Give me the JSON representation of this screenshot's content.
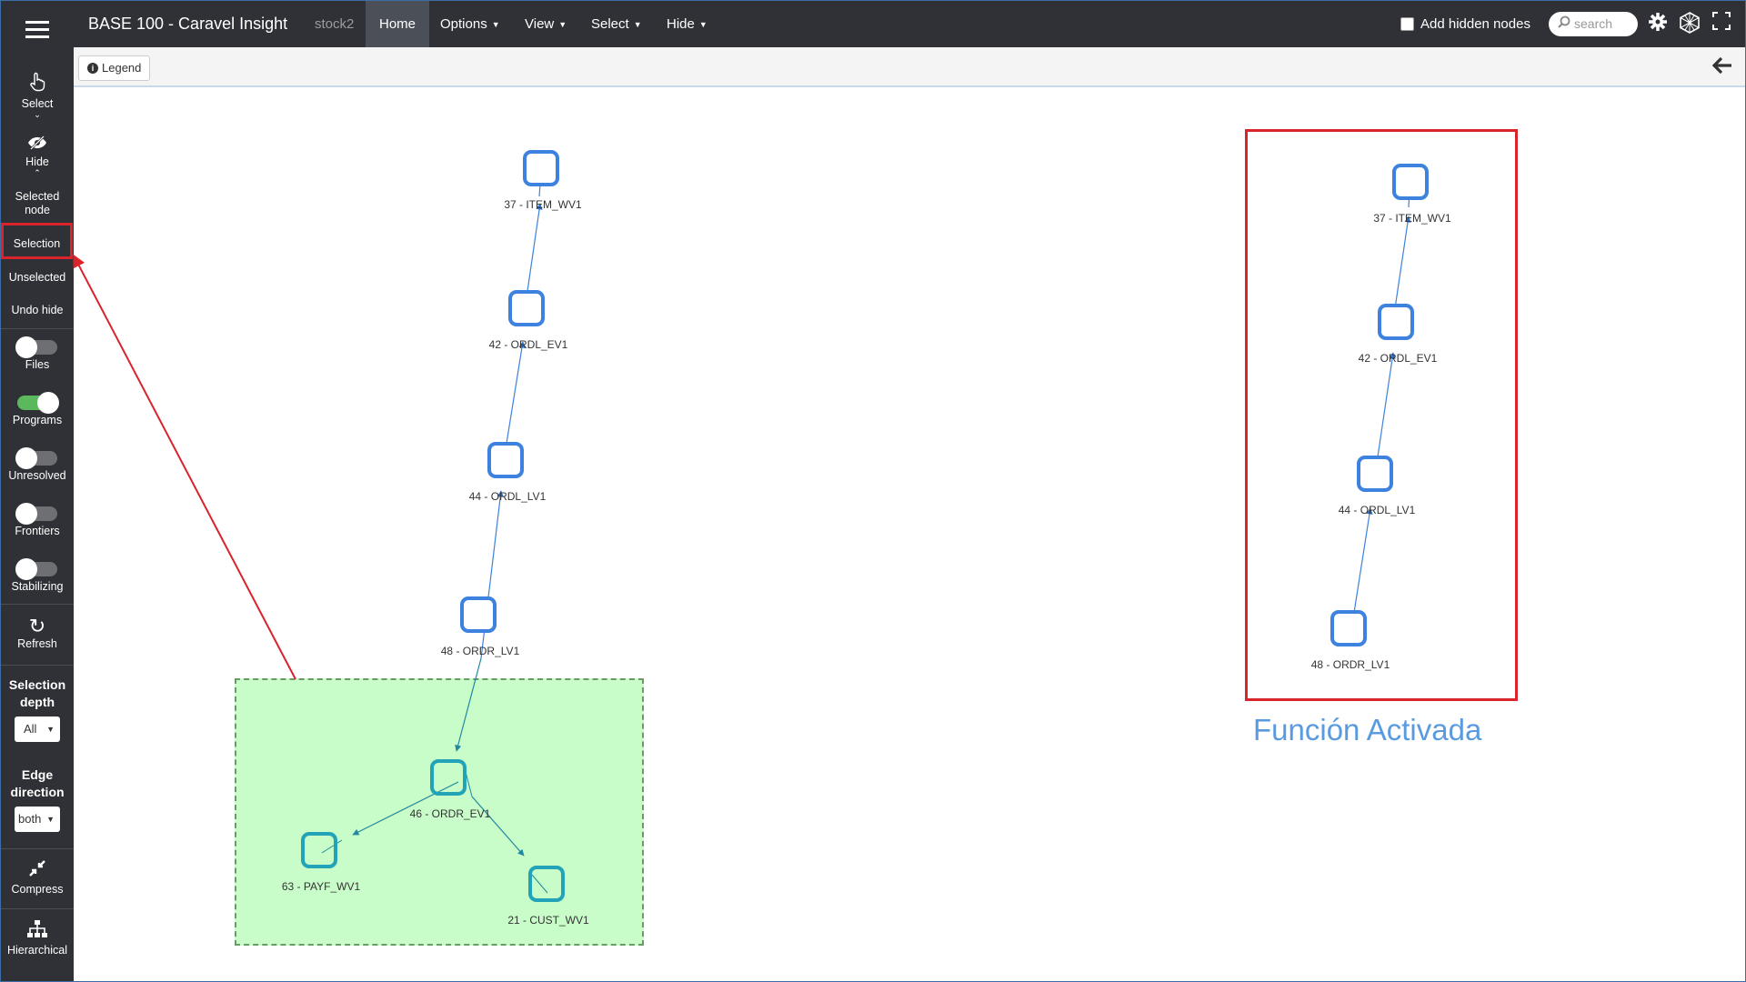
{
  "app": {
    "title": "BASE 100 - Caravel Insight",
    "project": "stock2"
  },
  "topnav": {
    "home": "Home",
    "options": "Options",
    "view": "View",
    "select": "Select",
    "hide": "Hide",
    "add_hidden_nodes": "Add hidden nodes",
    "search_placeholder": "search"
  },
  "subbar": {
    "legend": "Legend"
  },
  "sidebar": {
    "select": "Select",
    "hide": "Hide",
    "selected_node": "Selected node",
    "selection": "Selection",
    "unselected": "Unselected",
    "undo_hide": "Undo hide",
    "toggles": {
      "files": {
        "label": "Files",
        "on": false
      },
      "programs": {
        "label": "Programs",
        "on": true
      },
      "unresolved": {
        "label": "Unresolved",
        "on": false
      },
      "frontiers": {
        "label": "Frontiers",
        "on": false
      },
      "stabilizing": {
        "label": "Stabilizing",
        "on": false
      }
    },
    "refresh": "Refresh",
    "selection_depth_label": "Selection depth",
    "selection_depth_value": "All",
    "edge_direction_label": "Edge direction",
    "edge_direction_value": "both",
    "compress": "Compress",
    "hierarchical": "Hierarchical"
  },
  "graph": {
    "nodes": {
      "n37": "37 - ITEM_WV1",
      "n42": "42 - ORDL_EV1",
      "n44": "44 - ORDL_LV1",
      "n48": "48 - ORDR_LV1",
      "n46": "46 - ORDR_EV1",
      "n63": "63 - PAYF_WV1",
      "n21": "21 - CUST_WV1"
    },
    "right_nodes": {
      "n37": "37 - ITEM_WV1",
      "n42": "42 - ORDL_EV1",
      "n44": "44 - ORDL_LV1",
      "n48": "48 - ORDR_LV1"
    },
    "annotation": "Función Activada"
  },
  "colors": {
    "sidebar_bg": "#2f3136",
    "node_border": "#3d82de",
    "highlight_red": "#d9242b",
    "selection_fill": "#c8fcc8",
    "annotation_text": "#5a9be0"
  }
}
